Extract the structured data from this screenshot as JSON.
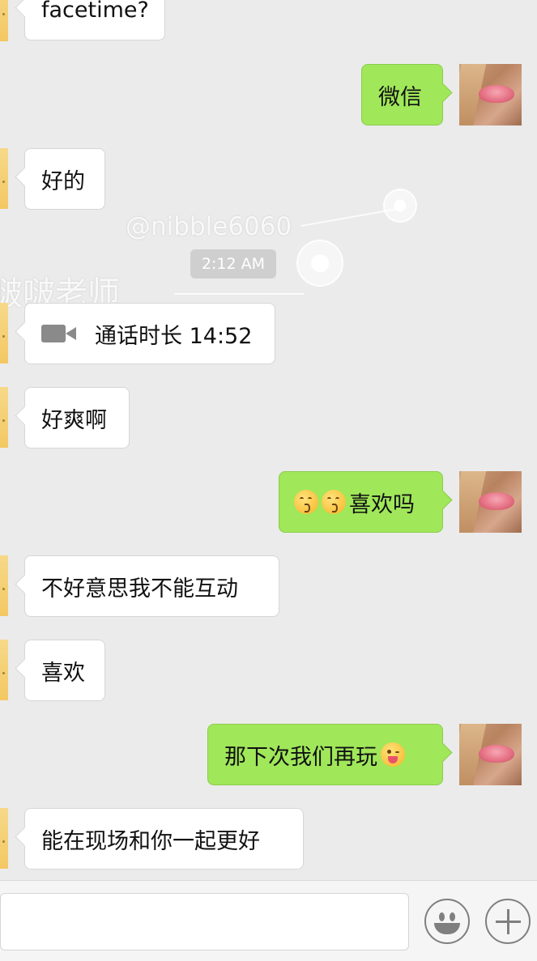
{
  "messages": [
    {
      "side": "in",
      "text": "facetime?"
    },
    {
      "side": "out",
      "text": "微信"
    },
    {
      "side": "in",
      "text": "好的"
    },
    {
      "side": "in",
      "call_label": "通话时长 14:52",
      "icon": "video-camera-icon"
    },
    {
      "side": "in",
      "text": "好爽啊"
    },
    {
      "side": "out",
      "emoji": [
        "kissing-face-icon",
        "kissing-face-icon"
      ],
      "text": "喜欢吗"
    },
    {
      "side": "in",
      "text": "不好意思我不能互动"
    },
    {
      "side": "in",
      "text": "喜欢"
    },
    {
      "side": "out",
      "text": "那下次我们再玩",
      "emoji_after": "winking-tongue-face-icon"
    },
    {
      "side": "in",
      "text": "能在现场和你一起更好"
    }
  ],
  "timestamp": "2:12 AM",
  "watermark": {
    "handle": "@nibble6060",
    "name": "啵啵老师"
  },
  "input": {
    "value": "",
    "placeholder": ""
  },
  "colors": {
    "background": "#ebebeb",
    "incoming_bubble": "#ffffff",
    "outgoing_bubble": "#a0e75a",
    "timestamp_pill": "#cfcfcf"
  },
  "icons": {
    "emoji_button": "smiley-face-icon",
    "more_button": "plus-icon"
  }
}
